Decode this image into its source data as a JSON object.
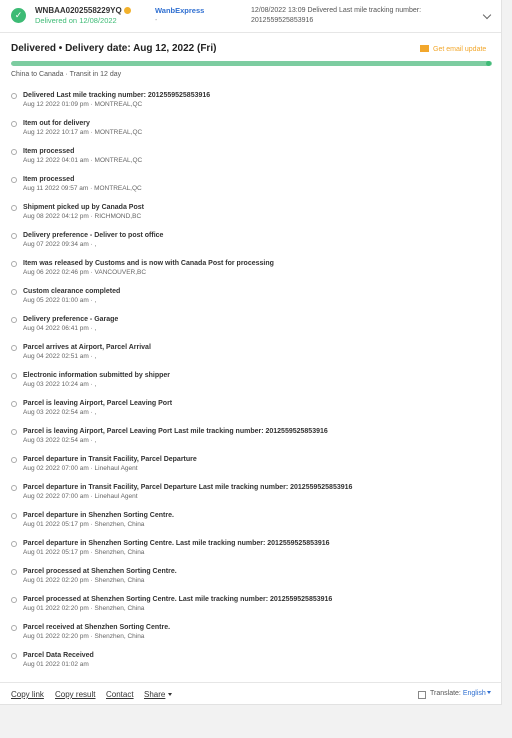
{
  "header": {
    "tracking_number": "WNBAA0202558229YQ",
    "delivered_on": "Delivered on 12/08/2022",
    "carrier": "WanbExpress",
    "carrier_sub": "-",
    "latest_event": "12/08/2022 13:09 Delivered Last mile tracking number: 2012559525853916"
  },
  "summary": {
    "status": "Delivered • Delivery date: Aug 12, 2022 (Fri)",
    "email_update": "Get email update",
    "route": "China to Canada · Transit in 12 day",
    "progress": 1.0
  },
  "events": [
    {
      "title": "Delivered Last mile tracking number: 2012559525853916",
      "meta": "Aug 12 2022 01:09 pm · MONTREAL,QC"
    },
    {
      "title": "Item out for delivery",
      "meta": "Aug 12 2022 10:17 am · MONTREAL,QC"
    },
    {
      "title": "Item processed",
      "meta": "Aug 12 2022 04:01 am · MONTREAL,QC"
    },
    {
      "title": "Item processed",
      "meta": "Aug 11 2022 09:57 am · MONTREAL,QC"
    },
    {
      "title": "Shipment picked up by Canada Post",
      "meta": "Aug 08 2022 04:12 pm · RICHMOND,BC"
    },
    {
      "title": "Delivery preference - Deliver to post office",
      "meta": "Aug 07 2022 09:34 am · ,"
    },
    {
      "title": "Item was released by Customs and is now with Canada Post for processing",
      "meta": "Aug 06 2022 02:46 pm · VANCOUVER,BC"
    },
    {
      "title": "Custom clearance completed",
      "meta": "Aug 05 2022 01:00 am · ,"
    },
    {
      "title": "Delivery preference - Garage",
      "meta": "Aug 04 2022 06:41 pm · ,"
    },
    {
      "title": "Parcel arrives at Airport, Parcel Arrival",
      "meta": "Aug 04 2022 02:51 am · ,"
    },
    {
      "title": "Electronic information submitted by shipper",
      "meta": "Aug 03 2022 10:24 am · ,"
    },
    {
      "title": "Parcel is leaving Airport, Parcel Leaving Port",
      "meta": "Aug 03 2022 02:54 am · ,"
    },
    {
      "title": "Parcel is leaving Airport, Parcel Leaving Port Last mile tracking number: 2012559525853916",
      "meta": "Aug 03 2022 02:54 am · ,"
    },
    {
      "title": "Parcel departure in Transit Facility, Parcel Departure",
      "meta": "Aug 02 2022 07:00 am · Linehaul Agent"
    },
    {
      "title": "Parcel departure in Transit Facility, Parcel Departure Last mile tracking number: 2012559525853916",
      "meta": "Aug 02 2022 07:00 am · Linehaul Agent"
    },
    {
      "title": "Parcel departure in Shenzhen Sorting Centre.",
      "meta": "Aug 01 2022 05:17 pm · Shenzhen, China"
    },
    {
      "title": "Parcel departure in Shenzhen Sorting Centre. Last mile tracking number: 2012559525853916",
      "meta": "Aug 01 2022 05:17 pm · Shenzhen, China"
    },
    {
      "title": "Parcel processed at Shenzhen Sorting Centre.",
      "meta": "Aug 01 2022 02:20 pm · Shenzhen, China"
    },
    {
      "title": "Parcel processed at Shenzhen Sorting Centre. Last mile tracking number: 2012559525853916",
      "meta": "Aug 01 2022 02:20 pm · Shenzhen, China"
    },
    {
      "title": "Parcel received at Shenzhen Sorting Centre.",
      "meta": "Aug 01 2022 02:20 pm · Shenzhen, China"
    },
    {
      "title": "Parcel Data Received",
      "meta": "Aug 01 2022 01:02 am"
    }
  ],
  "footer": {
    "copy_link": "Copy link",
    "copy_result": "Copy result",
    "contact": "Contact",
    "share": "Share",
    "translate_label": "Translate:",
    "language": "English"
  },
  "colors": {
    "success": "#3dbb75",
    "link": "#2f6fd1",
    "accent": "#f2a72c"
  }
}
